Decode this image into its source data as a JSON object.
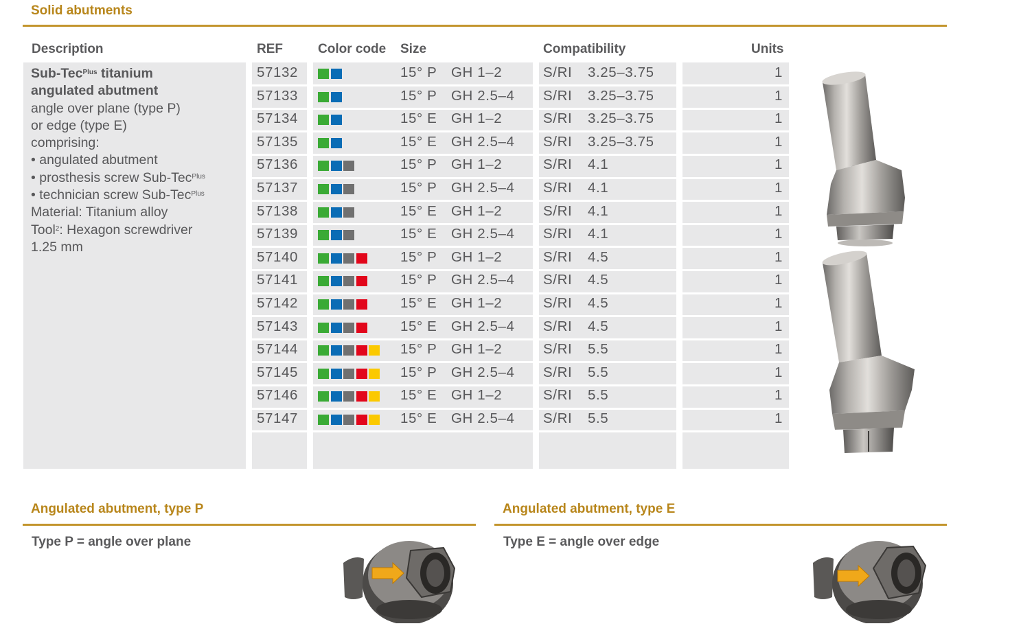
{
  "section_title": "Solid abutments",
  "headers": {
    "description": "Description",
    "ref": "REF",
    "color_code": "Color code",
    "size": "Size",
    "compatibility": "Compatibility",
    "units": "Units"
  },
  "description": {
    "title_1_main": "Sub-Tec",
    "title_1_sup": "Plus",
    "title_1_rest": " titanium",
    "title_2": "angulated abutment",
    "line_1": "angle over plane (type P)",
    "line_2": "or edge (type E)",
    "line_3": "comprising:",
    "bullet_1": "• angulated abutment",
    "bullet_2_main": "• prosthesis screw Sub-Tec",
    "bullet_2_sup": "Plus",
    "bullet_3_main": "• technician screw Sub-Tec",
    "bullet_3_sup": "Plus",
    "material": "Material: Titanium alloy",
    "tool_main": "Tool",
    "tool_sup": "2",
    "tool_rest": ": Hexagon screwdriver",
    "tool_size": "1.25 mm"
  },
  "colors": {
    "green": "#3aaa35",
    "blue": "#0a6cb5",
    "gray": "#707070",
    "red": "#e2061b",
    "yellow": "#fbc900",
    "accent": "#c3952d"
  },
  "rows": [
    {
      "ref": "57132",
      "colors": [
        "green",
        "blue"
      ],
      "angle": "15° P",
      "gh": "GH 1–2",
      "system": "S/RI",
      "dia": "3.25–3.75",
      "units": "1"
    },
    {
      "ref": "57133",
      "colors": [
        "green",
        "blue"
      ],
      "angle": "15° P",
      "gh": "GH 2.5–4",
      "system": "S/RI",
      "dia": "3.25–3.75",
      "units": "1"
    },
    {
      "ref": "57134",
      "colors": [
        "green",
        "blue"
      ],
      "angle": "15° E",
      "gh": "GH 1–2",
      "system": "S/RI",
      "dia": "3.25–3.75",
      "units": "1"
    },
    {
      "ref": "57135",
      "colors": [
        "green",
        "blue"
      ],
      "angle": "15° E",
      "gh": "GH 2.5–4",
      "system": "S/RI",
      "dia": "3.25–3.75",
      "units": "1"
    },
    {
      "ref": "57136",
      "colors": [
        "green",
        "blue",
        "gray"
      ],
      "angle": "15° P",
      "gh": "GH 1–2",
      "system": "S/RI",
      "dia": "4.1",
      "units": "1"
    },
    {
      "ref": "57137",
      "colors": [
        "green",
        "blue",
        "gray"
      ],
      "angle": "15° P",
      "gh": "GH 2.5–4",
      "system": "S/RI",
      "dia": "4.1",
      "units": "1"
    },
    {
      "ref": "57138",
      "colors": [
        "green",
        "blue",
        "gray"
      ],
      "angle": "15° E",
      "gh": "GH 1–2",
      "system": "S/RI",
      "dia": "4.1",
      "units": "1"
    },
    {
      "ref": "57139",
      "colors": [
        "green",
        "blue",
        "gray"
      ],
      "angle": "15° E",
      "gh": "GH 2.5–4",
      "system": "S/RI",
      "dia": "4.1",
      "units": "1"
    },
    {
      "ref": "57140",
      "colors": [
        "green",
        "blue",
        "gray",
        "red"
      ],
      "angle": "15° P",
      "gh": "GH 1–2",
      "system": "S/RI",
      "dia": "4.5",
      "units": "1"
    },
    {
      "ref": "57141",
      "colors": [
        "green",
        "blue",
        "gray",
        "red"
      ],
      "angle": "15° P",
      "gh": "GH 2.5–4",
      "system": "S/RI",
      "dia": "4.5",
      "units": "1"
    },
    {
      "ref": "57142",
      "colors": [
        "green",
        "blue",
        "gray",
        "red"
      ],
      "angle": "15° E",
      "gh": "GH 1–2",
      "system": "S/RI",
      "dia": "4.5",
      "units": "1"
    },
    {
      "ref": "57143",
      "colors": [
        "green",
        "blue",
        "gray",
        "red"
      ],
      "angle": "15° E",
      "gh": "GH 2.5–4",
      "system": "S/RI",
      "dia": "4.5",
      "units": "1"
    },
    {
      "ref": "57144",
      "colors": [
        "green",
        "blue",
        "gray",
        "red",
        "yellow"
      ],
      "angle": "15° P",
      "gh": "GH 1–2",
      "system": "S/RI",
      "dia": "5.5",
      "units": "1"
    },
    {
      "ref": "57145",
      "colors": [
        "green",
        "blue",
        "gray",
        "red",
        "yellow"
      ],
      "angle": "15° P",
      "gh": "GH 2.5–4",
      "system": "S/RI",
      "dia": "5.5",
      "units": "1"
    },
    {
      "ref": "57146",
      "colors": [
        "green",
        "blue",
        "gray",
        "red",
        "yellow"
      ],
      "angle": "15° E",
      "gh": "GH 1–2",
      "system": "S/RI",
      "dia": "5.5",
      "units": "1"
    },
    {
      "ref": "57147",
      "colors": [
        "green",
        "blue",
        "gray",
        "red",
        "yellow"
      ],
      "angle": "15° E",
      "gh": "GH 2.5–4",
      "system": "S/RI",
      "dia": "5.5",
      "units": "1"
    }
  ],
  "type_p": {
    "title": "Angulated abutment, type P",
    "text": "Type P = angle over plane",
    "image_icon": "abutment-type-p-illustration"
  },
  "type_e": {
    "title": "Angulated abutment, type E",
    "text": "Type E = angle over edge",
    "image_icon": "abutment-type-e-illustration"
  },
  "product_image_icon": "angulated-abutment-illustration"
}
